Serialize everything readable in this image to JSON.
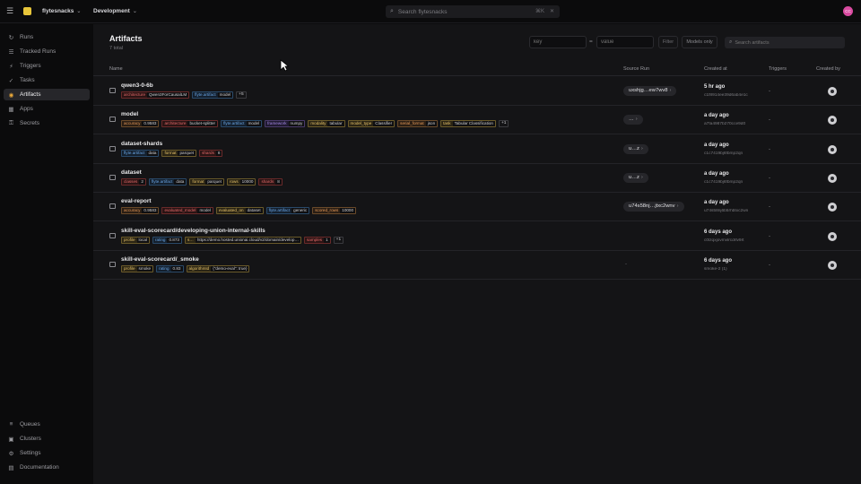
{
  "topbar": {
    "org": "flytesnacks",
    "env": "Development",
    "search_placeholder": "Search flytesnacks",
    "shortcut": "⌘K",
    "avatar_initials": "CC"
  },
  "sidebar": {
    "top_items": [
      {
        "label": "Runs",
        "icon": "runs-icon"
      },
      {
        "label": "Tracked Runs",
        "icon": "tracked-runs-icon"
      },
      {
        "label": "Triggers",
        "icon": "triggers-icon"
      },
      {
        "label": "Tasks",
        "icon": "tasks-icon"
      },
      {
        "label": "Artifacts",
        "icon": "artifacts-icon",
        "active": true
      },
      {
        "label": "Apps",
        "icon": "apps-icon"
      },
      {
        "label": "Secrets",
        "icon": "secrets-icon"
      }
    ],
    "bottom_items": [
      {
        "label": "Queues",
        "icon": "queues-icon"
      },
      {
        "label": "Clusters",
        "icon": "clusters-icon"
      },
      {
        "label": "Settings",
        "icon": "settings-icon"
      },
      {
        "label": "Documentation",
        "icon": "documentation-icon"
      }
    ]
  },
  "main": {
    "title": "Artifacts",
    "subtitle": "7 total",
    "filter": {
      "key_placeholder": "key",
      "eq": "=",
      "value_placeholder": "value",
      "filter_label": "Filter",
      "models_only_label": "Models only",
      "search_placeholder": "Search artifacts"
    },
    "columns": {
      "name": "Name",
      "source_run": "Source Run",
      "created_at": "Created at",
      "triggers": "Triggers",
      "created_by": "Created by"
    },
    "rows": [
      {
        "name": "qwen3-0-6b",
        "chips": [
          {
            "k": "architecture",
            "v": "Qwen3ForCausalLM",
            "c": "red"
          },
          {
            "k": "flyte.artifact",
            "v": "model",
            "c": "blue"
          }
        ],
        "more": "+5",
        "source_run": "uxshjg…ew7wv8",
        "created": "5 hr ago",
        "created_sub": "c1f8914ee39d6ab4e1c",
        "triggers": "-"
      },
      {
        "name": "model",
        "chips": [
          {
            "k": "accuracy",
            "v": "0.9583",
            "c": "orange"
          },
          {
            "k": "architecture",
            "v": "bucket-splitter",
            "c": "red"
          },
          {
            "k": "flyte.artifact",
            "v": "model",
            "c": "blue"
          },
          {
            "k": "framework",
            "v": "numpy",
            "c": "purple"
          },
          {
            "k": "modality",
            "v": "tabular",
            "c": "yellow"
          },
          {
            "k": "model_type",
            "v": "Classifier",
            "c": "yellow"
          },
          {
            "k": "serial_format",
            "v": "json",
            "c": "orange"
          },
          {
            "k": "task",
            "v": "Tabular Classification",
            "c": "yellow"
          }
        ],
        "more": "+1",
        "source_run": "…",
        "created": "a day ago",
        "created_sub": "a7fa4987b270cce9d0",
        "triggers": "-"
      },
      {
        "name": "dataset-shards",
        "chips": [
          {
            "k": "flyte.artifact",
            "v": "data",
            "c": "blue"
          },
          {
            "k": "format",
            "v": "parquet",
            "c": "yellow"
          },
          {
            "k": "shards",
            "v": "8",
            "c": "red"
          }
        ],
        "more": "",
        "source_run": "u…z",
        "created": "a day ago",
        "created_sub": "c1c7419bj6fbmp2qn",
        "triggers": "-"
      },
      {
        "name": "dataset",
        "chips": [
          {
            "k": "classes",
            "v": "2",
            "c": "red"
          },
          {
            "k": "flyte.artifact",
            "v": "data",
            "c": "blue"
          },
          {
            "k": "format",
            "v": "parquet",
            "c": "yellow"
          },
          {
            "k": "rows",
            "v": "10000",
            "c": "yellow"
          },
          {
            "k": "shards",
            "v": "8",
            "c": "red"
          }
        ],
        "more": "",
        "source_run": "u…z",
        "created": "a day ago",
        "created_sub": "c1c7419bj6fbmp2qn",
        "triggers": "-"
      },
      {
        "name": "eval-report",
        "chips": [
          {
            "k": "accuracy",
            "v": "0.9583",
            "c": "orange"
          },
          {
            "k": "evaluated_model",
            "v": "model",
            "c": "red"
          },
          {
            "k": "evaluated_on",
            "v": "dataset",
            "c": "yellow"
          },
          {
            "k": "flyte.artifact",
            "v": "generic",
            "c": "blue"
          },
          {
            "k": "scored_rows",
            "v": "10000",
            "c": "orange"
          }
        ],
        "more": "",
        "source_run": "u74s58nj…jtxc2wnv",
        "created": "a day ago",
        "created_sub": "u74s58nj6b5rhbtxc2wn",
        "triggers": "-"
      },
      {
        "name": "skill-eval-scorecard/developing-union-internal-skills",
        "chips": [
          {
            "k": "profile",
            "v": "local",
            "c": "yellow"
          },
          {
            "k": "rating",
            "v": "0.873",
            "c": "blue"
          },
          {
            "k": "s…",
            "v": "https://demo.hosted.unionai.cloud/v2/domain/develop…",
            "c": "yellow"
          },
          {
            "k": "samples",
            "v": "1",
            "c": "red"
          }
        ],
        "more": "+1",
        "source_run": "",
        "created": "6 days ago",
        "created_sub": "c0lzqxjovmvlrcdrlv9rt",
        "triggers": "-"
      },
      {
        "name": "skill-eval-scorecard/_smoke",
        "chips": [
          {
            "k": "profile",
            "v": "smoke",
            "c": "yellow"
          },
          {
            "k": "rating",
            "v": "0.83",
            "c": "blue"
          },
          {
            "k": "algorithmId",
            "v": "{\"demo-eval\": true}",
            "c": "yellow"
          }
        ],
        "more": "",
        "source_run": "-",
        "created": "6 days ago",
        "created_sub": "smoke-2 (1)",
        "triggers": "-"
      }
    ]
  }
}
